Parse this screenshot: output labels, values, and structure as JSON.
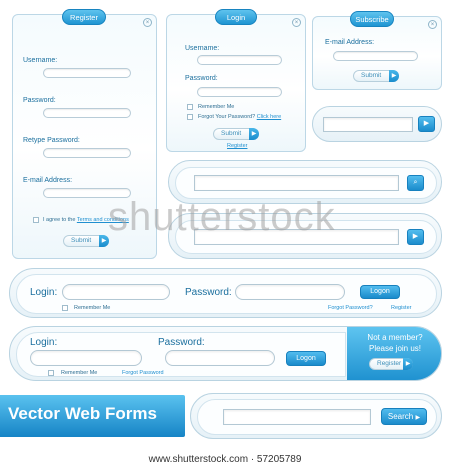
{
  "register": {
    "tab": "Register",
    "close": "×",
    "username": "Username:",
    "password": "Password:",
    "retype": "Retype Password:",
    "email": "E-mail Address:",
    "agree_prefix": "I agree to the ",
    "agree_link": "Terms and conditions",
    "submit": "Submit",
    "arrow": "▶"
  },
  "login_card": {
    "tab": "Login",
    "close": "×",
    "username": "Username:",
    "password": "Password:",
    "remember": "Remember Me",
    "forgot": "Forgot Your Password? ",
    "forgot_link": "Click here",
    "submit": "Submit",
    "arrow": "▶",
    "register_link": "Register"
  },
  "subscribe": {
    "tab": "Subscribe",
    "close": "×",
    "email": "E-mail Address:",
    "submit": "Submit",
    "arrow": "▶"
  },
  "search_bars": {
    "play": "▶",
    "magnifier": "⌕"
  },
  "login_bar1": {
    "login": "Login:",
    "password": "Password:",
    "button": "Logon",
    "remember": "Remember Me",
    "forgot": "Forgot Password?",
    "register": "Register"
  },
  "login_bar2": {
    "login": "Login:",
    "password": "Password:",
    "button": "Logon",
    "remember": "Remember Me",
    "forgot": "Forgot Password",
    "not_member": "Not a member?",
    "join": "Please join us!",
    "register": "Register",
    "arrow": "▶"
  },
  "banner": {
    "title": "Vector Web Forms"
  },
  "search_final": {
    "button": "Search",
    "arrow": "▶"
  },
  "watermark": "shutterstock",
  "footer": "www.shutterstock.com · 57205789"
}
